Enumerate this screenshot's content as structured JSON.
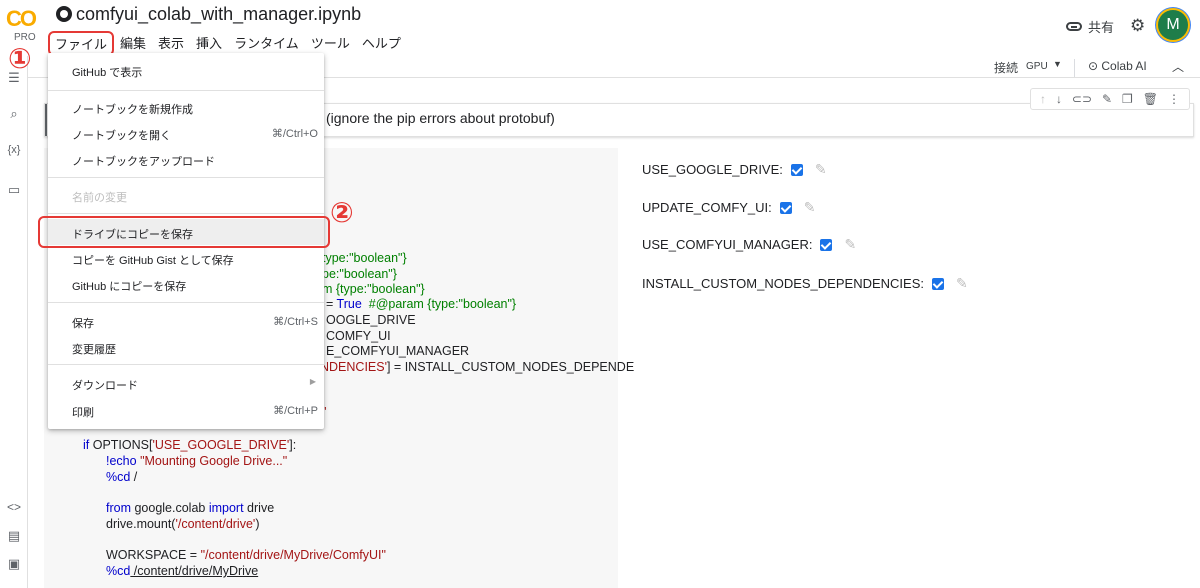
{
  "app": {
    "logo_text": "CO",
    "logo_pro": "PRO",
    "doc_title": "comfyui_colab_with_manager.ipynb"
  },
  "menubar": [
    "ファイル",
    "編集",
    "表示",
    "挿入",
    "ランタイム",
    "ツール",
    "ヘルプ"
  ],
  "header_right": {
    "share_label": "共有",
    "avatar_letter": "M"
  },
  "toolbar": {
    "connect_label": "接続",
    "gpu_label": "GPU",
    "colab_ai_label": "Colab AI"
  },
  "markdown_cell": {
    "text": "(ignore the pip errors about protobuf)"
  },
  "file_menu": {
    "items": [
      {
        "label": "GitHub で表示",
        "shortcut": ""
      },
      {
        "label": "ノートブックを新規作成",
        "shortcut": ""
      },
      {
        "label": "ノートブックを開く",
        "shortcut": "⌘/Ctrl+O"
      },
      {
        "label": "ノートブックをアップロード",
        "shortcut": ""
      },
      {
        "label": "名前の変更",
        "shortcut": ""
      },
      {
        "label": "ドライブにコピーを保存",
        "shortcut": ""
      },
      {
        "label": "コピーを GitHub Gist として保存",
        "shortcut": ""
      },
      {
        "label": "GitHub にコピーを保存",
        "shortcut": ""
      },
      {
        "label": "保存",
        "shortcut": "⌘/Ctrl+S"
      },
      {
        "label": "変更履歴",
        "shortcut": ""
      },
      {
        "label": "ダウンロード",
        "shortcut": ""
      },
      {
        "label": "印刷",
        "shortcut": "⌘/Ctrl+P"
      }
    ]
  },
  "markers": {
    "one": "①",
    "two": "②"
  },
  "code_lines": {
    "l1": "type:\"boolean\"}",
    "l2": "pe:\"boolean\"}",
    "l3": "m {type:\"boolean\"}",
    "l4_a": "= ",
    "l4_b": "True",
    "l4_c": "  #@param {type:\"boolean\"}",
    "l5": "OOGLE_DRIVE",
    "l6": "COMFY_UI",
    "l7": "E_COMFYUI_MANAGER",
    "l8_a": "NDENCIES'",
    "l8_b": "] = INSTALL_CUSTOM_NODES_DEPENDE",
    "l9": "\"",
    "if_kw": "if",
    "if_rest_a": " OPTIONS[",
    "if_str": "'USE_GOOGLE_DRIVE'",
    "if_rest_b": "]:",
    "echo_cmd": "!echo",
    "echo_str": " \"Mounting Google Drive...\"",
    "cd1_cmd": "%cd",
    "cd1_arg": " /",
    "from_kw": "from",
    "from_mod": " google.colab ",
    "import_kw": "import",
    "import_name": " drive",
    "mount_a": "drive.mount(",
    "mount_str": "'/content/drive'",
    "mount_b": ")",
    "ws_a": "WORKSPACE = ",
    "ws_str": "\"/content/drive/MyDrive/ComfyUI\"",
    "cd2_cmd": "%cd",
    "cd2_arg": " /content/drive/MyDrive"
  },
  "form_fields": [
    {
      "label": "USE_GOOGLE_DRIVE:",
      "checked": true
    },
    {
      "label": "UPDATE_COMFY_UI:",
      "checked": true
    },
    {
      "label": "USE_COMFYUI_MANAGER:",
      "checked": true
    },
    {
      "label": "INSTALL_CUSTOM_NODES_DEPENDENCIES:",
      "checked": true
    }
  ],
  "colors": {
    "accent": "#1a73e8",
    "highlight_red": "#e53935",
    "logo_orange": "#f9ab00"
  }
}
